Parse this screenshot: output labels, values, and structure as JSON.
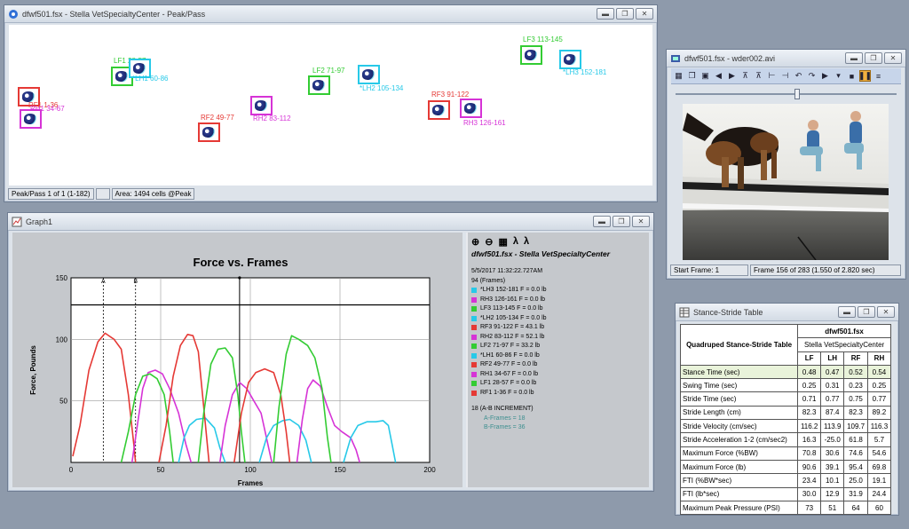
{
  "peak_window": {
    "title": "dfwf501.fsx - Stella  VetSpecialtyCenter - Peak/Pass",
    "status_pass": "Peak/Pass 1 of 1 (1-182)",
    "status_area": "Area: 1494 cells @Peak",
    "paws": [
      {
        "label": "RF1 1-36",
        "color": "#e53935"
      },
      {
        "label": "RH1 34-67",
        "color": "#d633d6"
      },
      {
        "label": "LF1 28-57",
        "color": "#33cc33"
      },
      {
        "label": "*LH1 60-86",
        "color": "#27c9e8"
      },
      {
        "label": "RF2 49-77",
        "color": "#e53935"
      },
      {
        "label": "RH2 83-112",
        "color": "#d633d6"
      },
      {
        "label": "LF2 71-97",
        "color": "#33cc33"
      },
      {
        "label": "*LH2 105-134",
        "color": "#27c9e8"
      },
      {
        "label": "RF3 91-122",
        "color": "#e53935"
      },
      {
        "label": "RH3 126-161",
        "color": "#d633d6"
      },
      {
        "label": "LF3 113-145",
        "color": "#33cc33"
      },
      {
        "label": "*LH3 152-181",
        "color": "#27c9e8"
      }
    ]
  },
  "graph_window": {
    "title": "Graph1",
    "legend_title": "dfwf501.fsx - Stella  VetSpecialtyCenter",
    "timestamp": "5/5/2017 11:32:22.727AM",
    "frames_line": "94  (Frames)",
    "legend_items": [
      {
        "text": "*LH3 152-181 F = 0.0 lb",
        "color": "#27c9e8"
      },
      {
        "text": "RH3 126-161 F = 0.0 lb",
        "color": "#d633d6"
      },
      {
        "text": "LF3 113-145 F = 0.0 lb",
        "color": "#33cc33"
      },
      {
        "text": "*LH2 105-134 F = 0.0 lb",
        "color": "#27c9e8"
      },
      {
        "text": "RF3 91-122 F = 43.1 lb",
        "color": "#e53935"
      },
      {
        "text": "RH2 83-112 F = 52.1 lb",
        "color": "#d633d6"
      },
      {
        "text": "LF2 71-97 F = 33.2 lb",
        "color": "#33cc33"
      },
      {
        "text": "*LH1 60-86 F = 0.0 lb",
        "color": "#27c9e8"
      },
      {
        "text": "RF2 49-77 F = 0.0 lb",
        "color": "#e53935"
      },
      {
        "text": "RH1 34-67 F = 0.0 lb",
        "color": "#d633d6"
      },
      {
        "text": "LF1 28-57 F = 0.0 lb",
        "color": "#33cc33"
      },
      {
        "text": "RF1 1-36 F = 0.0 lb",
        "color": "#e53935"
      }
    ],
    "increment_line": "18  (A-B INCREMENT)",
    "a_frames": "A-Frames = 18",
    "b_frames": "B-Frames = 36"
  },
  "chart_data": {
    "type": "line",
    "title": "Force vs. Frames",
    "xlabel": "Frames",
    "ylabel": "Force, Pounds",
    "xlim": [
      0,
      200
    ],
    "ylim": [
      0,
      150
    ],
    "xticks": [
      0,
      50,
      100,
      150,
      200
    ],
    "yticks": [
      50,
      100,
      150
    ],
    "cursor_labels": {
      "a": "A",
      "b": "B"
    },
    "cursors": {
      "a": 18,
      "b": 36,
      "current": 94
    },
    "threshold": 128,
    "series": [
      {
        "color": "#e53935",
        "points": [
          [
            1,
            5
          ],
          [
            5,
            30
          ],
          [
            10,
            75
          ],
          [
            15,
            98
          ],
          [
            19,
            105
          ],
          [
            24,
            100
          ],
          [
            28,
            92
          ],
          [
            32,
            55
          ],
          [
            35,
            15
          ],
          [
            36,
            0
          ]
        ]
      },
      {
        "color": "#d633d6",
        "points": [
          [
            34,
            0
          ],
          [
            37,
            30
          ],
          [
            40,
            60
          ],
          [
            43,
            73
          ],
          [
            47,
            75
          ],
          [
            51,
            72
          ],
          [
            55,
            60
          ],
          [
            60,
            40
          ],
          [
            64,
            15
          ],
          [
            67,
            0
          ]
        ]
      },
      {
        "color": "#33cc33",
        "points": [
          [
            28,
            0
          ],
          [
            32,
            25
          ],
          [
            36,
            55
          ],
          [
            40,
            70
          ],
          [
            44,
            72
          ],
          [
            48,
            68
          ],
          [
            52,
            55
          ],
          [
            55,
            25
          ],
          [
            57,
            0
          ]
        ]
      },
      {
        "color": "#27c9e8",
        "points": [
          [
            60,
            0
          ],
          [
            63,
            20
          ],
          [
            66,
            30
          ],
          [
            70,
            35
          ],
          [
            75,
            36
          ],
          [
            80,
            28
          ],
          [
            83,
            12
          ],
          [
            86,
            0
          ]
        ]
      },
      {
        "color": "#e53935",
        "points": [
          [
            49,
            0
          ],
          [
            53,
            30
          ],
          [
            57,
            70
          ],
          [
            61,
            95
          ],
          [
            65,
            104
          ],
          [
            68,
            103
          ],
          [
            71,
            90
          ],
          [
            74,
            45
          ],
          [
            77,
            0
          ]
        ]
      },
      {
        "color": "#d633d6",
        "points": [
          [
            83,
            0
          ],
          [
            86,
            30
          ],
          [
            90,
            55
          ],
          [
            94,
            65
          ],
          [
            98,
            60
          ],
          [
            102,
            50
          ],
          [
            106,
            40
          ],
          [
            109,
            20
          ],
          [
            112,
            0
          ]
        ]
      },
      {
        "color": "#33cc33",
        "points": [
          [
            71,
            0
          ],
          [
            74,
            40
          ],
          [
            78,
            80
          ],
          [
            82,
            92
          ],
          [
            86,
            93
          ],
          [
            90,
            85
          ],
          [
            93,
            55
          ],
          [
            95,
            25
          ],
          [
            97,
            0
          ]
        ]
      },
      {
        "color": "#27c9e8",
        "points": [
          [
            105,
            0
          ],
          [
            109,
            20
          ],
          [
            113,
            30
          ],
          [
            118,
            34
          ],
          [
            122,
            35
          ],
          [
            127,
            30
          ],
          [
            131,
            18
          ],
          [
            134,
            0
          ]
        ]
      },
      {
        "color": "#e53935",
        "points": [
          [
            91,
            0
          ],
          [
            95,
            40
          ],
          [
            99,
            65
          ],
          [
            103,
            73
          ],
          [
            108,
            76
          ],
          [
            113,
            73
          ],
          [
            117,
            55
          ],
          [
            120,
            25
          ],
          [
            122,
            0
          ]
        ]
      },
      {
        "color": "#d633d6",
        "points": [
          [
            126,
            0
          ],
          [
            129,
            35
          ],
          [
            132,
            60
          ],
          [
            135,
            67
          ],
          [
            139,
            62
          ],
          [
            143,
            45
          ],
          [
            147,
            30
          ],
          [
            151,
            25
          ],
          [
            156,
            20
          ],
          [
            159,
            10
          ],
          [
            161,
            0
          ]
        ]
      },
      {
        "color": "#33cc33",
        "points": [
          [
            113,
            0
          ],
          [
            116,
            45
          ],
          [
            120,
            88
          ],
          [
            123,
            103
          ],
          [
            127,
            100
          ],
          [
            132,
            95
          ],
          [
            136,
            85
          ],
          [
            140,
            60
          ],
          [
            143,
            20
          ],
          [
            145,
            0
          ]
        ]
      },
      {
        "color": "#27c9e8",
        "points": [
          [
            152,
            0
          ],
          [
            156,
            20
          ],
          [
            160,
            30
          ],
          [
            165,
            33
          ],
          [
            170,
            33
          ],
          [
            174,
            34
          ],
          [
            177,
            30
          ],
          [
            179,
            15
          ],
          [
            181,
            0
          ]
        ]
      }
    ]
  },
  "video_window": {
    "title": "dfwf501.fsx - wder002.avi",
    "start_frame": "Start Frame: 1",
    "frame_info": "Frame 156 of 283  (1.550 of 2.820 sec)"
  },
  "table_window": {
    "title": "Stance-Stride Table",
    "header_title": "Quadruped Stance-Stride Table",
    "file": "dfwf501.fsx",
    "subject": "Stella  VetSpecialtyCenter",
    "columns": [
      "LF",
      "LH",
      "RF",
      "RH"
    ],
    "rows": [
      {
        "label": "Stance Time (sec)",
        "values": [
          "0.48",
          "0.47",
          "0.52",
          "0.54"
        ]
      },
      {
        "label": "Swing Time (sec)",
        "values": [
          "0.25",
          "0.31",
          "0.23",
          "0.25"
        ]
      },
      {
        "label": "Stride Time (sec)",
        "values": [
          "0.71",
          "0.77",
          "0.75",
          "0.77"
        ]
      },
      {
        "label": "Stride Length (cm)",
        "values": [
          "82.3",
          "87.4",
          "82.3",
          "89.2"
        ]
      },
      {
        "label": "Stride Velocity (cm/sec)",
        "values": [
          "116.2",
          "113.9",
          "109.7",
          "116.3"
        ]
      },
      {
        "label": "Stride Acceleration 1-2 (cm/sec2)",
        "values": [
          "16.3",
          "-25.0",
          "61.8",
          "5.7"
        ]
      },
      {
        "label": "Maximum Force (%BW)",
        "values": [
          "70.8",
          "30.6",
          "74.6",
          "54.6"
        ]
      },
      {
        "label": "Maximum Force (lb)",
        "values": [
          "90.6",
          "39.1",
          "95.4",
          "69.8"
        ]
      },
      {
        "label": "FTI (%BW*sec)",
        "values": [
          "23.4",
          "10.1",
          "25.0",
          "19.1"
        ]
      },
      {
        "label": "FTI (lb*sec)",
        "values": [
          "30.0",
          "12.9",
          "31.9",
          "24.4"
        ]
      },
      {
        "label": "Maximum Peak Pressure (PSI)",
        "values": [
          "73",
          "51",
          "64",
          "60"
        ]
      }
    ]
  }
}
